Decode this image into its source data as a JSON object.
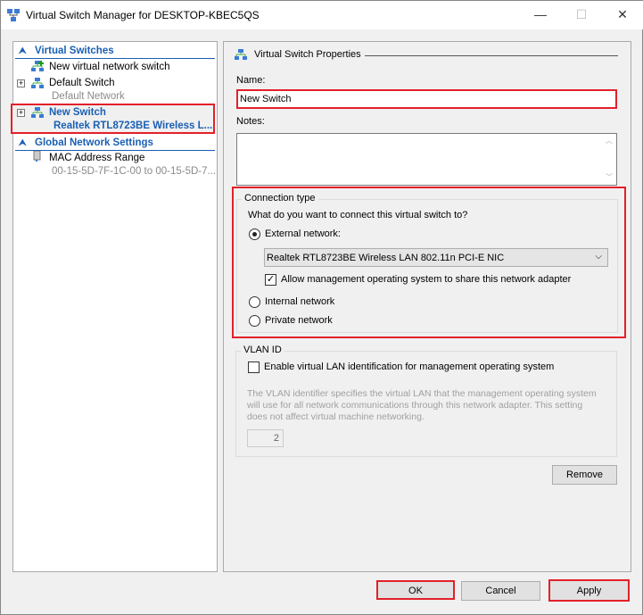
{
  "window": {
    "title": "Virtual Switch Manager for DESKTOP-KBEC5QS",
    "minimize": "—",
    "maximize": "☐",
    "close": "✕"
  },
  "sidebar": {
    "virtual_switches": "Virtual Switches",
    "new_switch": "New virtual network switch",
    "default_switch": "Default Switch",
    "default_switch_sub": "Default Network",
    "selected_switch": "New Switch",
    "selected_switch_sub": "Realtek RTL8723BE Wireless L...",
    "global": "Global Network Settings",
    "mac": "MAC Address Range",
    "mac_sub": "00-15-5D-7F-1C-00 to 00-15-5D-7..."
  },
  "props": {
    "header": "Virtual Switch Properties",
    "name_label": "Name:",
    "name_value": "New Switch",
    "notes_label": "Notes:",
    "notes_value": "",
    "conn_title": "Connection type",
    "conn_question": "What do you want to connect this virtual switch to?",
    "external": "External network:",
    "adapter": "Realtek RTL8723BE Wireless LAN 802.11n PCI-E NIC",
    "allow_mgmt": "Allow management operating system to share this network adapter",
    "internal": "Internal network",
    "private": "Private network",
    "vlan_title": "VLAN ID",
    "vlan_enable": "Enable virtual LAN identification for management operating system",
    "vlan_desc": "The VLAN identifier specifies the virtual LAN that the management operating system will use for all network communications through this network adapter. This setting does not affect virtual machine networking.",
    "vlan_value": "2",
    "remove": "Remove"
  },
  "footer": {
    "ok": "OK",
    "cancel": "Cancel",
    "apply": "Apply"
  }
}
